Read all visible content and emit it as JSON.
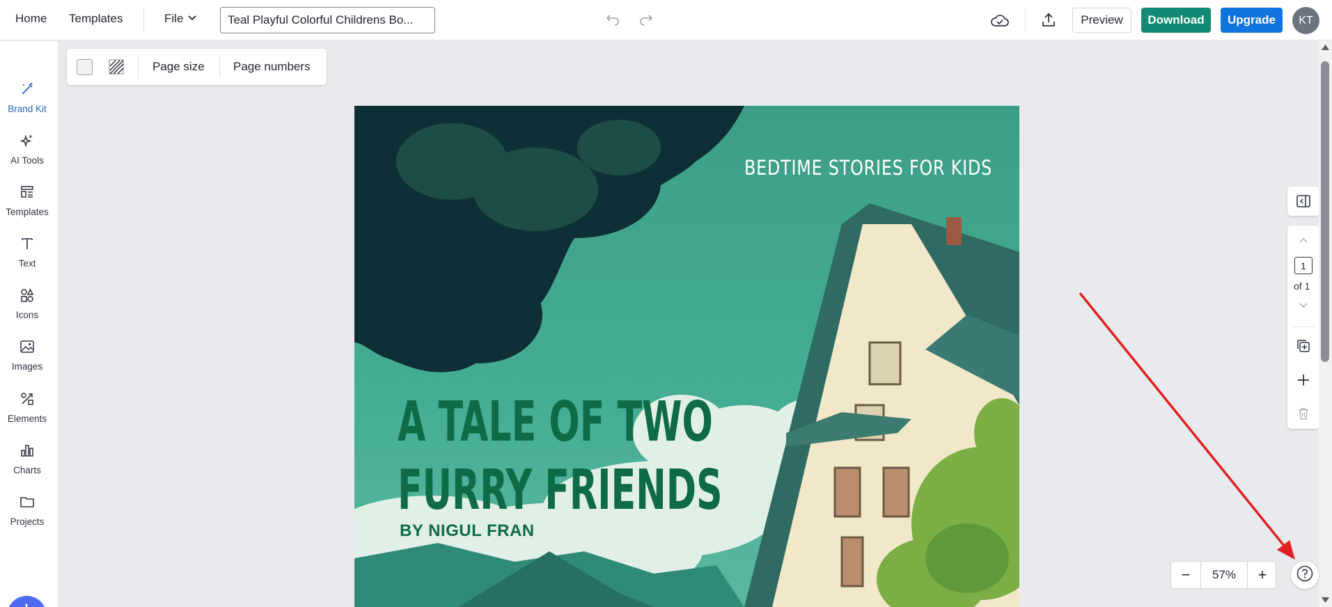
{
  "topbar": {
    "home_label": "Home",
    "templates_label": "Templates",
    "file_label": "File",
    "document_title": "Teal Playful Colorful Childrens Bo...",
    "preview_label": "Preview",
    "download_label": "Download",
    "upgrade_label": "Upgrade",
    "avatar_initials": "KT",
    "download_color": "#108a72",
    "upgrade_color": "#0f74e0"
  },
  "sidebar": {
    "items": [
      {
        "label": "Brand Kit",
        "icon": "magic-wand-icon"
      },
      {
        "label": "AI Tools",
        "icon": "sparkles-icon"
      },
      {
        "label": "Templates",
        "icon": "templates-icon"
      },
      {
        "label": "Text",
        "icon": "text-icon"
      },
      {
        "label": "Icons",
        "icon": "shapes-icon"
      },
      {
        "label": "Images",
        "icon": "image-icon"
      },
      {
        "label": "Elements",
        "icon": "elements-icon"
      },
      {
        "label": "Charts",
        "icon": "bar-chart-icon"
      },
      {
        "label": "Projects",
        "icon": "folder-icon"
      }
    ],
    "active_color": "#2a63b8",
    "assistant_icon": "ai-assistant-icon"
  },
  "page_toolbar": {
    "page_size_label": "Page size",
    "page_numbers_label": "Page numbers"
  },
  "canvas": {
    "subtitle": "BEDTIME STORIES FOR KIDS",
    "title_line1": "A TALE OF TWO",
    "title_line2": "FURRY FRIENDS",
    "byline": "BY NIGUL FRAN",
    "title_color": "#0f6b45"
  },
  "page_nav": {
    "current_page": "1",
    "total_label": "of 1"
  },
  "zoom": {
    "level": "57%",
    "minus": "−",
    "plus": "+"
  }
}
